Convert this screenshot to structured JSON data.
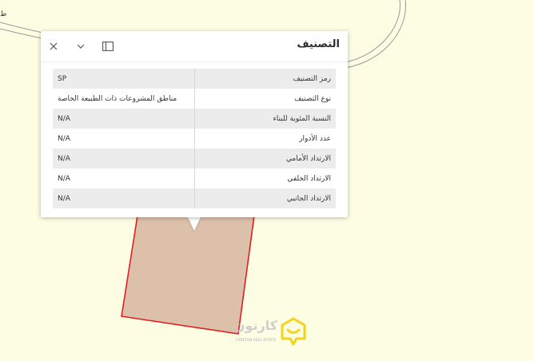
{
  "map": {
    "corner_label": "ط",
    "parcel_fill": "#dcc0aa",
    "parcel_stroke": "#e02020",
    "boundary_color": "#9a9a9a"
  },
  "popup": {
    "title": "التصنيف",
    "icons": {
      "close": "close-icon",
      "collapse": "chevron-down-icon",
      "dock": "dock-panel-icon"
    },
    "rows": [
      {
        "label": "رمز التصنيف",
        "value": "SP"
      },
      {
        "label": "نوع التصنيف",
        "value": "مناطق المشروعات ذات الطبيعة الخاصة"
      },
      {
        "label": "النسبة المئوية للبناء",
        "value": "N/A"
      },
      {
        "label": "عدد الأدوار",
        "value": "N/A"
      },
      {
        "label": "الارتداد الأمامي",
        "value": "N/A"
      },
      {
        "label": "الارتداد الخلفي",
        "value": "N/A"
      },
      {
        "label": "الارتداد الجانبي",
        "value": "N/A"
      }
    ]
  },
  "watermark": {
    "name": "كارتون",
    "subtitle": "CARETON REAL ESTATE",
    "accent": "#f2d21a"
  }
}
